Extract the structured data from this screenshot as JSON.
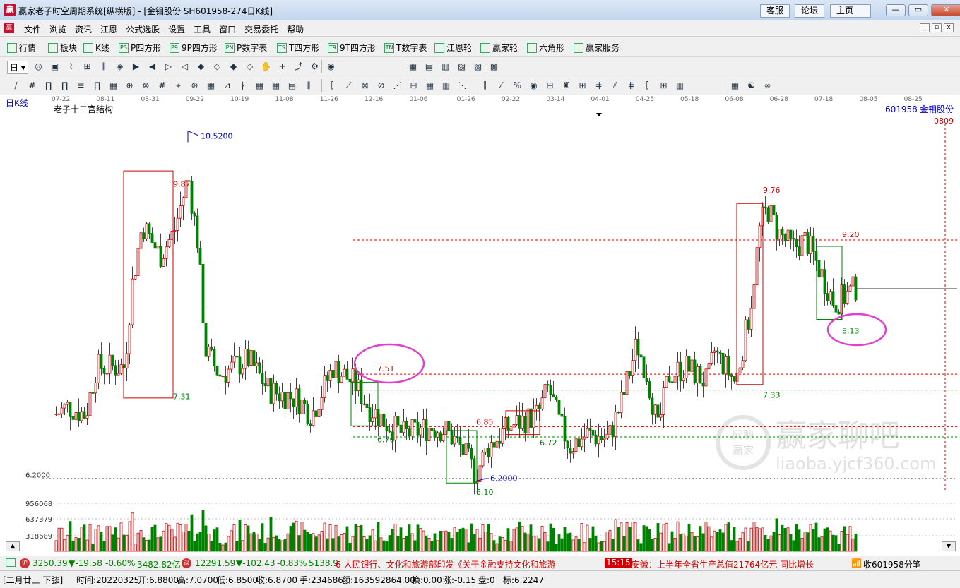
{
  "window": {
    "title": "赢家老子时空周期系统[纵横版] - [金钼股份   SH601958-274日K线]",
    "buttons": {
      "service": "客服",
      "forum": "论坛",
      "home": "主页"
    },
    "logo_text": "赢"
  },
  "menu": [
    "文件",
    "浏览",
    "资讯",
    "江恩",
    "公式选股",
    "设置",
    "工具",
    "窗口",
    "交易委托",
    "帮助"
  ],
  "toolbar1": [
    {
      "label": "行情",
      "icon": "grid-icon"
    },
    {
      "label": "板块",
      "icon": "sector-icon"
    },
    {
      "label": "K线",
      "icon": "candlestick-icon"
    },
    {
      "label": "P四方形",
      "icon": "ps-icon",
      "badge": "PS"
    },
    {
      "label": "9P四方形",
      "icon": "p9-icon",
      "badge": "P9"
    },
    {
      "label": "P数字表",
      "icon": "pn-icon",
      "badge": "PN"
    },
    {
      "label": "T四方形",
      "icon": "ts-icon",
      "badge": "TS"
    },
    {
      "label": "9T四方形",
      "icon": "t9-icon",
      "badge": "T9"
    },
    {
      "label": "T数字表",
      "icon": "tn-icon",
      "badge": "TN"
    },
    {
      "label": "江恩轮",
      "icon": "gann-wheel-icon"
    },
    {
      "label": "赢家轮",
      "icon": "winner-wheel-icon"
    },
    {
      "label": "六角形",
      "icon": "hexagon-icon"
    },
    {
      "label": "赢家服务",
      "icon": "dollar-icon"
    }
  ],
  "toolbar2": {
    "period_label": "日"
  },
  "chart": {
    "period_label": "日K线",
    "indicator_name": "老子十二宫结构",
    "stock_code": "601958",
    "stock_name": "金钼股份",
    "top_right_code": "0809",
    "date_axis": [
      "07-22",
      "08-11",
      "08-31",
      "09-22",
      "10-19",
      "11-08",
      "11-26",
      "12-16",
      "01-06",
      "01-26",
      "02-22",
      "03-14",
      "04-01",
      "04-25",
      "05-18",
      "06-08",
      "06-28",
      "07-18",
      "08-05",
      "08-25"
    ],
    "price_labels": {
      "high_mark": "10.5200",
      "low_mark": "6.2000",
      "left_low": "6.2000",
      "box1_top": "9.87",
      "box1_bottom": "7.31",
      "box2_top": "7.51",
      "box2_bottom": "6.76",
      "box3_bottom": "6.10",
      "box4_top": "6.85",
      "box4_bottom": "6.72",
      "box5_top": "9.76",
      "box5_bottom": "7.33",
      "box6_top": "9.20",
      "box6_bottom": "8.13"
    },
    "volume_labels": [
      "956068",
      "637379",
      "318689"
    ],
    "watermark": {
      "title": "赢家聊吧",
      "url": "liaoba.yjcf360.com",
      "seal_top": "网聊",
      "seal_bottom": "赢家"
    }
  },
  "colors": {
    "up": "#d00000",
    "down": "#008000",
    "title_bar": "#c4d6ee",
    "highlight_circle": "#e040d0"
  },
  "statusbar": {
    "sh_index": "3250.39",
    "sh_change": "▼-19.58",
    "sh_pct": "-0.60%",
    "sh_amount": "3482.82亿",
    "sz_index": "12291.59",
    "sz_change": "▼-102.43",
    "sz_pct": "-0.83%",
    "sz_amount": "5138.9",
    "news_ticker": "6 人民银行、文化和旅游部印发《关于金融支持文化和旅游",
    "news_time": "15:15",
    "news_text": "安徽：上半年全省生产总值21764亿元 同比增长",
    "right_text": "收601958分笔"
  },
  "infobar": {
    "lunar": "[二月廿三 下弦]",
    "time": "时间:20220325",
    "open": "开:6.8800",
    "high": "高:7.0700",
    "low": "低:6.8500",
    "close": "收:6.8700",
    "hands": "手:234686",
    "amount": "额:163592864.00",
    "turnover": "换:0.00",
    "change": "涨:-0.15",
    "pan": "盘:0",
    "mark": "标:6.2247"
  }
}
